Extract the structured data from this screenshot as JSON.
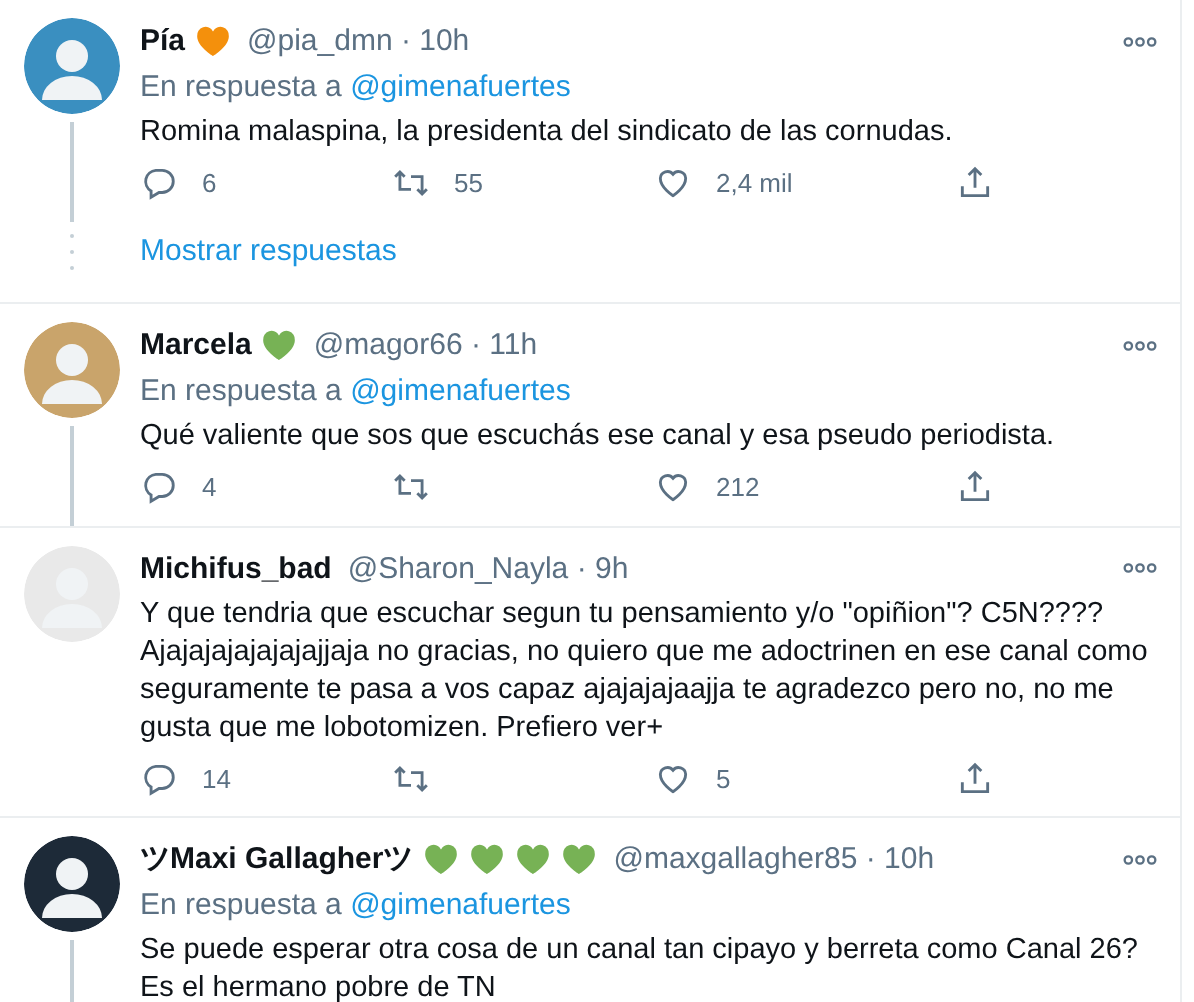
{
  "tweets": [
    {
      "name": "Pía",
      "hearts": [
        {
          "color": "#f4900c"
        }
      ],
      "meta": "@pia_dmn · 10h",
      "reply_to": {
        "prefix": "En respuesta a",
        "handle": "@gimenafuertes"
      },
      "text": "Romina malaspina, la presidenta del sindicato de las cornudas.",
      "replies": "6",
      "retweets": "55",
      "likes": "2,4 mil",
      "thread_line": true,
      "show_replies": "Mostrar respuestas"
    },
    {
      "name": "Marcela",
      "hearts": [
        {
          "color": "#77b255"
        }
      ],
      "meta": "@magor66 · 11h",
      "reply_to": {
        "prefix": "En respuesta a",
        "handle": "@gimenafuertes"
      },
      "text": "Qué valiente que sos que escuchás ese canal y esa pseudo periodista.",
      "replies": "4",
      "likes": "212",
      "thread_line": true
    },
    {
      "name": "Michifus_bad",
      "meta": "@Sharon_Nayla · 9h",
      "text": "Y que tendria que escuchar segun tu pensamiento y/o \"opiñion\"? C5N???? Ajajajajajajajajjaja no gracias, no quiero que me adoctrinen en ese canal como seguramente te pasa a vos capaz ajajajajaajja te agradezco pero no, no me gusta que me lobotomizen. Prefiero ver+",
      "replies": "14",
      "likes": "5",
      "thread_line": false
    },
    {
      "name": "ツMaxi Gallagherツ",
      "hearts": [
        {
          "color": "#77b255"
        },
        {
          "color": "#77b255"
        },
        {
          "color": "#77b255"
        },
        {
          "color": "#77b255"
        }
      ],
      "meta": "@maxgallagher85 · 10h",
      "reply_to": {
        "prefix": "En respuesta a",
        "handle": "@gimenafuertes"
      },
      "text": "Se puede esperar otra cosa de un canal tan cipayo y berreta como Canal 26? Es el hermano pobre de TN",
      "thread_line": true
    }
  ]
}
